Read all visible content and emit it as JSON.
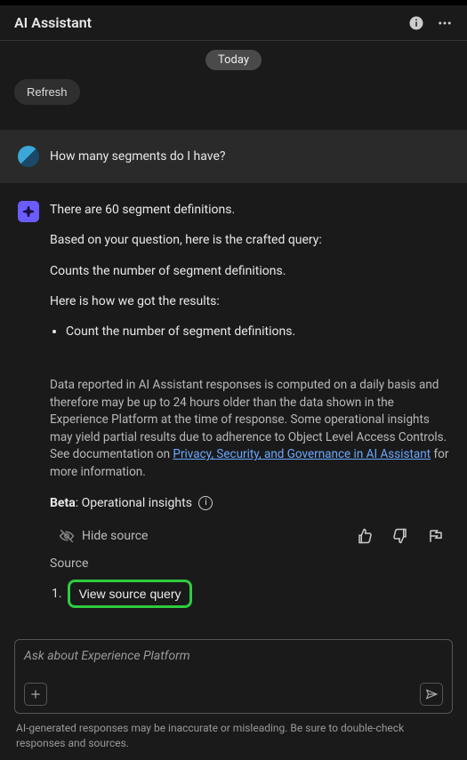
{
  "header": {
    "title": "AI Assistant"
  },
  "date_chip": "Today",
  "refresh_label": "Refresh",
  "user_message": "How many segments do I have?",
  "ai": {
    "p1": "There are 60 segment definitions.",
    "p2": "Based on your question, here is the crafted query:",
    "p3": "Counts the number of segment definitions.",
    "p4": "Here is how we got the results:",
    "bullet1": "Count the number of segment definitions.",
    "disclaimer_pre": "Data reported in AI Assistant responses is computed on a daily basis and therefore may be up to 24 hours older than the data shown in the Experience Platform at the time of response. Some operational insights may yield partial results due to adherence to Object Level Access Controls. See documentation on ",
    "disclaimer_link": "Privacy, Security, and Governance in AI Assistant",
    "disclaimer_post": " for more information.",
    "beta_label": "Beta",
    "beta_text": ": Operational insights",
    "hide_source": "Hide source",
    "source_label": "Source",
    "source_num": "1.",
    "view_query": "View source query"
  },
  "composer": {
    "placeholder": "Ask about Experience Platform"
  },
  "footer": "AI-generated responses may be inaccurate or misleading. Be sure to double-check responses and sources."
}
